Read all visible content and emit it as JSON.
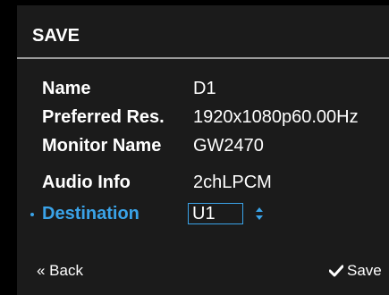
{
  "header": {
    "title": "SAVE"
  },
  "rows": [
    {
      "label": "Name",
      "value": "D1"
    },
    {
      "label": "Preferred Res.",
      "value": "1920x1080p60.00Hz"
    },
    {
      "label": "Monitor Name",
      "value": "GW2470"
    },
    {
      "label": "Audio Info",
      "value": "2chLPCM"
    },
    {
      "label": "Destination",
      "value": "U1"
    }
  ],
  "footer": {
    "back_label": "« Back",
    "save_label": "Save"
  },
  "colors": {
    "accent": "#3aa3e8",
    "panel": "#1b1b1b",
    "divider": "#9a9a9a"
  },
  "icons": {
    "destination_stepper": "up-down-arrows-icon",
    "save": "check-icon"
  }
}
